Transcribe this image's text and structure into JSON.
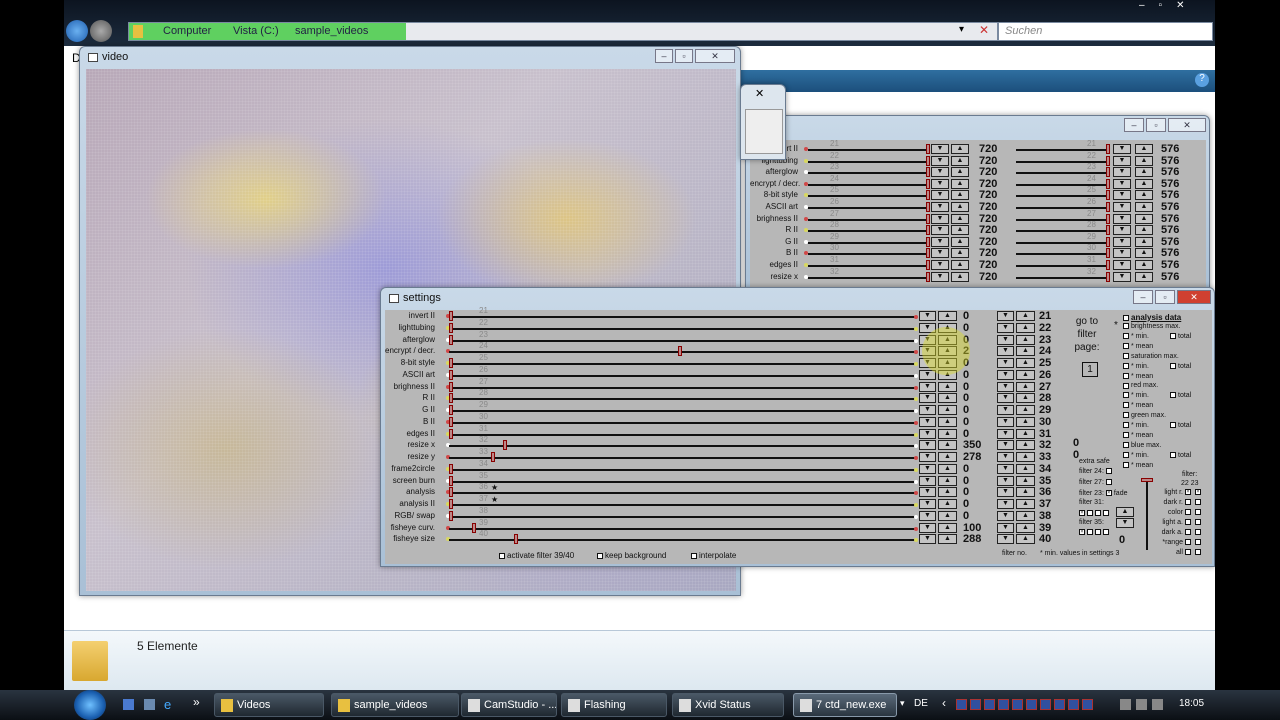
{
  "explorer": {
    "breadcrumb": [
      "Computer",
      "Vista (C:)",
      "sample_videos"
    ],
    "search_placeholder": "Suchen",
    "menu_letter": "D",
    "status": "5 Elemente"
  },
  "video_window": {
    "title": "video"
  },
  "filter_window": {
    "rows": [
      {
        "label": "invert II",
        "num": "21",
        "dot": "red",
        "a": "720",
        "b": "576"
      },
      {
        "label": "lighttubing",
        "num": "22",
        "dot": "yellow",
        "a": "720",
        "b": "576"
      },
      {
        "label": "afterglow",
        "num": "23",
        "dot": "white",
        "a": "720",
        "b": "576"
      },
      {
        "label": "encrypt / decr.",
        "num": "24",
        "dot": "red",
        "a": "720",
        "b": "576"
      },
      {
        "label": "8-bit style",
        "num": "25",
        "dot": "yellow",
        "a": "720",
        "b": "576"
      },
      {
        "label": "ASCII art",
        "num": "26",
        "dot": "white",
        "a": "720",
        "b": "576"
      },
      {
        "label": "brighness II",
        "num": "27",
        "dot": "red",
        "a": "720",
        "b": "576"
      },
      {
        "label": "R II",
        "num": "28",
        "dot": "yellow",
        "a": "720",
        "b": "576"
      },
      {
        "label": "G II",
        "num": "29",
        "dot": "white",
        "a": "720",
        "b": "576"
      },
      {
        "label": "B II",
        "num": "30",
        "dot": "red",
        "a": "720",
        "b": "576"
      },
      {
        "label": "edges II",
        "num": "31",
        "dot": "yellow",
        "a": "720",
        "b": "576"
      },
      {
        "label": "resize x",
        "num": "32",
        "dot": "white",
        "a": "720",
        "b": "576"
      }
    ]
  },
  "settings": {
    "title": "settings",
    "rows": [
      {
        "label": "invert II",
        "num": "21",
        "dot": "red",
        "fraction": 0,
        "value": "0",
        "star": ""
      },
      {
        "label": "lighttubing",
        "num": "22",
        "dot": "yellow",
        "fraction": 0,
        "value": "0",
        "star": ""
      },
      {
        "label": "afterglow",
        "num": "23",
        "dot": "white",
        "fraction": 0,
        "value": "0",
        "star": ""
      },
      {
        "label": "encrypt / decr.",
        "num": "24",
        "dot": "red",
        "fraction": 0.49,
        "value": "2",
        "star": ""
      },
      {
        "label": "8-bit style",
        "num": "25",
        "dot": "yellow",
        "fraction": 0,
        "value": "0",
        "star": ""
      },
      {
        "label": "ASCII art",
        "num": "26",
        "dot": "white",
        "fraction": 0,
        "value": "0",
        "star": ""
      },
      {
        "label": "brighness II",
        "num": "27",
        "dot": "red",
        "fraction": 0,
        "value": "0",
        "star": ""
      },
      {
        "label": "R II",
        "num": "28",
        "dot": "yellow",
        "fraction": 0,
        "value": "0",
        "star": ""
      },
      {
        "label": "G II",
        "num": "29",
        "dot": "white",
        "fraction": 0,
        "value": "0",
        "star": ""
      },
      {
        "label": "B II",
        "num": "30",
        "dot": "red",
        "fraction": 0,
        "value": "0",
        "star": ""
      },
      {
        "label": "edges II",
        "num": "31",
        "dot": "yellow",
        "fraction": 0,
        "value": "0",
        "star": ""
      },
      {
        "label": "resize x",
        "num": "32",
        "dot": "white",
        "fraction": 0.115,
        "value": "350",
        "star": ""
      },
      {
        "label": "resize y",
        "num": "33",
        "dot": "red",
        "fraction": 0.09,
        "value": "278",
        "star": ""
      },
      {
        "label": "frame2circle",
        "num": "34",
        "dot": "yellow",
        "fraction": 0,
        "value": "0",
        "star": ""
      },
      {
        "label": "screen burn",
        "num": "35",
        "dot": "white",
        "fraction": 0,
        "value": "0",
        "star": ""
      },
      {
        "label": "analysis",
        "num": "36",
        "dot": "red",
        "fraction": 0,
        "value": "0",
        "star": "★"
      },
      {
        "label": "analysis II",
        "num": "37",
        "dot": "yellow",
        "fraction": 0,
        "value": "0",
        "star": "★"
      },
      {
        "label": "RGB/ swap",
        "num": "38",
        "dot": "white",
        "fraction": 0,
        "value": "0",
        "star": ""
      },
      {
        "label": "fisheye curv.",
        "num": "39",
        "dot": "red",
        "fraction": 0.05,
        "value": "100",
        "star": ""
      },
      {
        "label": "fisheye size",
        "num": "40",
        "dot": "yellow",
        "fraction": 0.14,
        "value": "288",
        "star": ""
      }
    ],
    "options": [
      "activate filter 39/40",
      "keep background",
      "interpolate"
    ],
    "goto": {
      "line1": "go to",
      "line2": "filter",
      "line3": "page:",
      "page": "1"
    },
    "analysis": {
      "star": "*",
      "title": "analysis data",
      "items": [
        {
          "label": "brightness max.",
          "total": ""
        },
        {
          "label": "* min.",
          "total": "total"
        },
        {
          "label": "* mean",
          "total": ""
        },
        {
          "label": "saturation max.",
          "total": ""
        },
        {
          "label": "* min.",
          "total": "total"
        },
        {
          "label": "* mean",
          "total": ""
        },
        {
          "label": "red max.",
          "total": ""
        },
        {
          "label": "* min.",
          "total": "total"
        },
        {
          "label": "* mean",
          "total": ""
        },
        {
          "label": "green max.",
          "total": ""
        },
        {
          "label": "* min.",
          "total": "total"
        },
        {
          "label": "* mean",
          "total": ""
        },
        {
          "label": "blue max.",
          "total": ""
        },
        {
          "label": "* min.",
          "total": "total"
        },
        {
          "label": "* mean",
          "total": ""
        }
      ]
    },
    "extra": {
      "zero1": "0",
      "zero2": "0",
      "title": "extra safe",
      "f24": "filter 24:",
      "f27": "filter 27:",
      "f23": "filter 23:",
      "fade": "fade",
      "f31": "filter 31:",
      "f35": "filter 35:",
      "zero3": "0"
    },
    "filter_table": {
      "title": "filter:",
      "cols": "22  23",
      "rows": [
        "light r.",
        "dark r.",
        "color",
        "light a.",
        "dark a.",
        "*range",
        "all"
      ]
    },
    "footer": {
      "filter_no": "filter no.",
      "note": "* min. values in settings 3"
    }
  },
  "taskbar": {
    "items": [
      "Videos",
      "sample_videos",
      "CamStudio - ...",
      "Flashing",
      "Xvid Status",
      "7 ctd_new.exe"
    ],
    "lang": "DE",
    "clock": "18:05",
    "more": "»"
  },
  "colors": {
    "red": "#d04848",
    "yellow": "#d8d860",
    "white": "#ffffff"
  }
}
